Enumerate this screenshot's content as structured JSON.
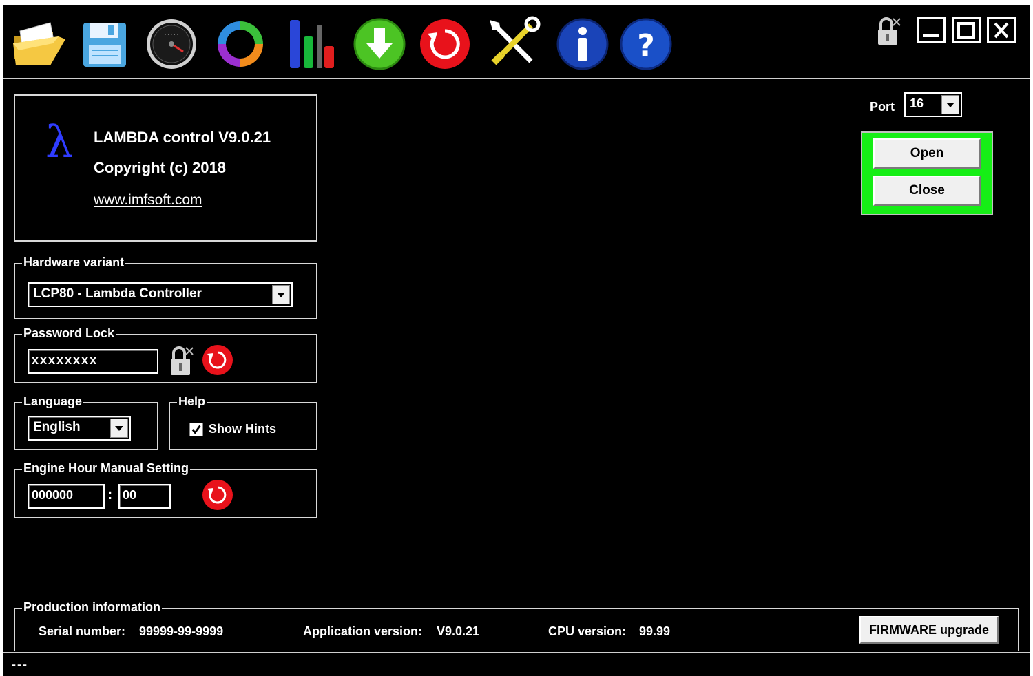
{
  "toolbar": {
    "icons": [
      "open-folder-icon",
      "save-disk-icon",
      "gauge-icon",
      "refresh-cycle-icon",
      "bar-graph-icon",
      "download-arrow-icon",
      "reset-icon",
      "tools-icon",
      "info-icon",
      "help-icon"
    ]
  },
  "window_controls": [
    "lock-icon",
    "minimize-icon",
    "maximize-icon",
    "close-icon"
  ],
  "about": {
    "symbol": "λ",
    "title": "LAMBDA control  V9.0.21",
    "copyright": "Copyright (c) 2018",
    "link": "www.imfsoft.com"
  },
  "hardware": {
    "title": "Hardware variant",
    "selected": "LCP80 - Lambda Controller"
  },
  "password": {
    "title": "Password Lock",
    "value": "xxxxxxxx"
  },
  "language": {
    "title": "Language",
    "selected": "English"
  },
  "help": {
    "title": "Help",
    "show_hints_label": "Show Hints",
    "show_hints_checked": true
  },
  "engine_hour": {
    "title": "Engine Hour Manual Setting",
    "hours": "000000",
    "separator": ":",
    "minutes": "00"
  },
  "port": {
    "label": "Port",
    "selected": "16"
  },
  "buttons": {
    "open": "Open",
    "close": "Close",
    "firmware": "FIRMWARE upgrade"
  },
  "production": {
    "title": "Production information",
    "serial_label": "Serial number:",
    "serial_value": "99999-99-9999",
    "app_label": "Application version:",
    "app_value": "V9.0.21",
    "cpu_label": "CPU version:",
    "cpu_value": "99.99"
  },
  "status": {
    "text": "---"
  },
  "colors": {
    "background": "#000000",
    "accent_green": "#16ee16",
    "lambda_blue": "#2f3cff",
    "reset_red": "#e8121b"
  }
}
